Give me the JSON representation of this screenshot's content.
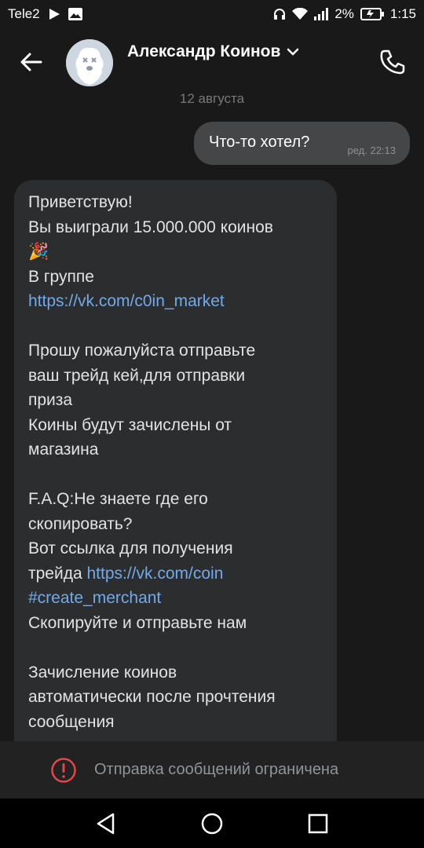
{
  "status_bar": {
    "carrier": "Tele2",
    "battery_percent": "2%",
    "time": "1:15",
    "icons": [
      "play-icon",
      "image-icon",
      "headphones-icon",
      "wifi-icon",
      "signal-icon",
      "battery-icon"
    ]
  },
  "header": {
    "contact_name": "Александр Коинов",
    "icons": [
      "back-arrow-icon",
      "chevron-down-icon",
      "phone-icon"
    ]
  },
  "chat": {
    "date_separator": "12 августа",
    "outgoing": {
      "text": "Что-то хотел?",
      "meta": "ред. 22:13"
    },
    "incoming": {
      "lines": [
        {
          "text": "Приветствую!"
        },
        {
          "text": "Вы выиграли 15.000.000 коинов"
        },
        {
          "text": "🎉"
        },
        {
          "text": "В группе"
        },
        {
          "text": "https://vk.com/c0in_market",
          "link": true
        },
        {
          "text": ""
        },
        {
          "text": "Прошу пожалуйста отправьте"
        },
        {
          "text": "ваш трейд кей,для отправки"
        },
        {
          "text": "приза"
        },
        {
          "text": "Коины будут зачислены от"
        },
        {
          "text": "магазина"
        },
        {
          "text": ""
        },
        {
          "text": "F.A.Q:Не знаете где его"
        },
        {
          "text": "скопировать?"
        },
        {
          "text": "Вот ссылка для получения"
        },
        {
          "text": "трейда ",
          "link_text": "https://vk.com/coin"
        },
        {
          "text": "#create_merchant",
          "link": true
        },
        {
          "text": "Скопируйте и отправьте нам"
        },
        {
          "text": ""
        },
        {
          "text": "Зачисление коинов"
        },
        {
          "text": "автоматически после прочтения"
        },
        {
          "text": "сообщения"
        }
      ]
    }
  },
  "restriction": {
    "text": "Отправка сообщений ограничена",
    "icon": "warning-circle-icon",
    "color": "#e64646"
  },
  "nav_bar": {
    "icons": [
      "back-triangle-icon",
      "home-circle-icon",
      "recents-square-icon"
    ]
  },
  "colors": {
    "background": "#19191a",
    "incoming_bubble": "#2c2d2e",
    "outgoing_bubble": "#454647",
    "link": "#71aaeb"
  }
}
